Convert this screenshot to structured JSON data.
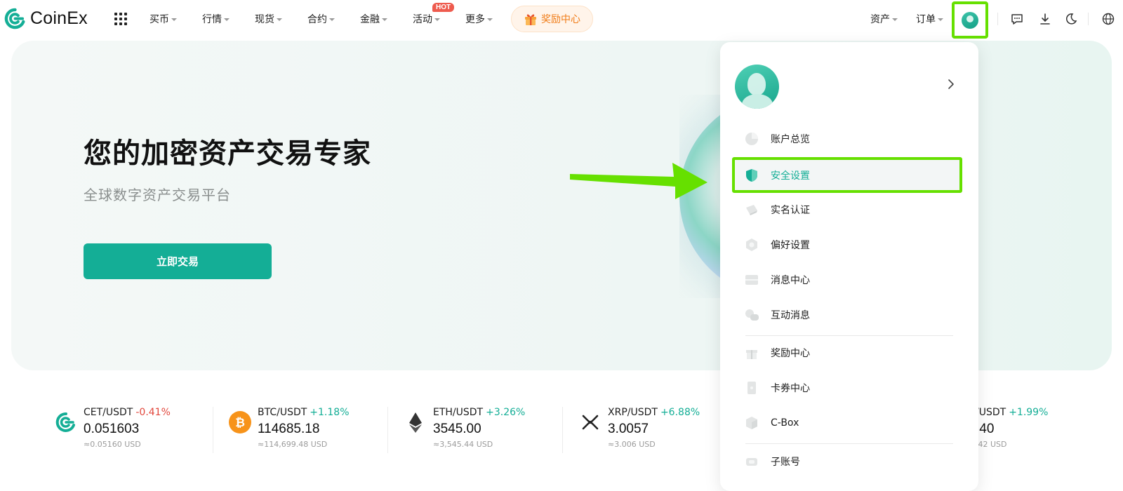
{
  "brand": {
    "name": "CoinEx",
    "accent": "#14ae96",
    "highlight": "#66e000"
  },
  "nav": {
    "items": [
      {
        "label": "买币"
      },
      {
        "label": "行情"
      },
      {
        "label": "现货"
      },
      {
        "label": "合约"
      },
      {
        "label": "金融"
      },
      {
        "label": "活动"
      },
      {
        "label": "更多"
      }
    ],
    "hot_badge": "HOT",
    "reward_label": "奖励中心",
    "right": {
      "assets": "资产",
      "orders": "订单"
    }
  },
  "hero": {
    "title": "您的加密资产交易专家",
    "subtitle": "全球数字资产交易平台",
    "cta": "立即交易"
  },
  "ticker": [
    {
      "pair": "CET/USDT",
      "change": "-0.41%",
      "direction": "down",
      "price": "0.051603",
      "usd": "≈0.05160 USD",
      "icon": "cet-icon"
    },
    {
      "pair": "BTC/USDT",
      "change": "+1.18%",
      "direction": "up",
      "price": "114685.18",
      "usd": "≈114,699.48 USD",
      "icon": "btc-icon"
    },
    {
      "pair": "ETH/USDT",
      "change": "+3.26%",
      "direction": "up",
      "price": "3545.00",
      "usd": "≈3,545.44 USD",
      "icon": "eth-icon"
    },
    {
      "pair": "XRP/USDT",
      "change": "+6.88%",
      "direction": "up",
      "price": "3.0057",
      "usd": "≈3.006 USD",
      "icon": "xrp-icon"
    },
    {
      "pair": "/USDT",
      "change": "+1.99%",
      "direction": "up",
      "price": ".40",
      "usd": ".42 USD",
      "icon": ""
    }
  ],
  "dropdown": {
    "items": [
      {
        "label": "账户总览",
        "icon": "pie-chart-icon"
      },
      {
        "label": "安全设置",
        "icon": "shield-icon",
        "active": true
      },
      {
        "label": "实名认证",
        "icon": "id-card-icon"
      },
      {
        "label": "偏好设置",
        "icon": "settings-icon"
      },
      {
        "label": "消息中心",
        "icon": "inbox-icon"
      },
      {
        "label": "互动消息",
        "icon": "chat-icon"
      },
      {
        "label": "奖励中心",
        "icon": "gift-icon"
      },
      {
        "label": "卡券中心",
        "icon": "coupon-icon"
      },
      {
        "label": "C-Box",
        "icon": "box-icon"
      },
      {
        "label": "子账号",
        "icon": "sub-account-icon"
      }
    ]
  }
}
